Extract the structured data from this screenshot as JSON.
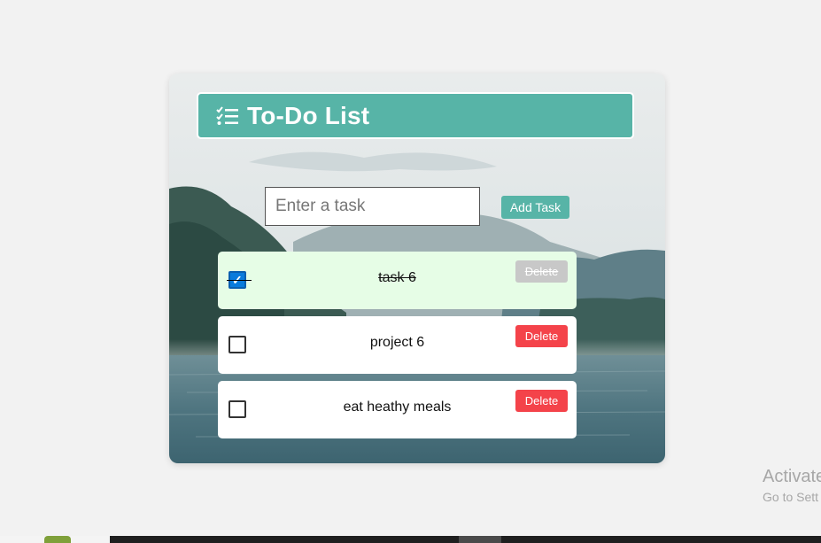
{
  "app": {
    "title": "To-Do List",
    "title_icon": "checklist-icon",
    "accent_color": "#57b4a7"
  },
  "input": {
    "placeholder": "Enter a task",
    "value": ""
  },
  "add_button": {
    "label": "Add Task"
  },
  "tasks": [
    {
      "text": "task 6",
      "completed": true,
      "delete_label": "Delete"
    },
    {
      "text": "project 6",
      "completed": false,
      "delete_label": "Delete"
    },
    {
      "text": "eat heathy meals",
      "completed": false,
      "delete_label": "Delete"
    }
  ],
  "colors": {
    "delete_active": "#f4434a",
    "delete_disabled": "#c8c8c8",
    "completed_background": "#e6fde6",
    "checkbox_checked": "#0a7bdc"
  },
  "watermark": {
    "line1": "Activate",
    "line2": "Go to Sett"
  }
}
